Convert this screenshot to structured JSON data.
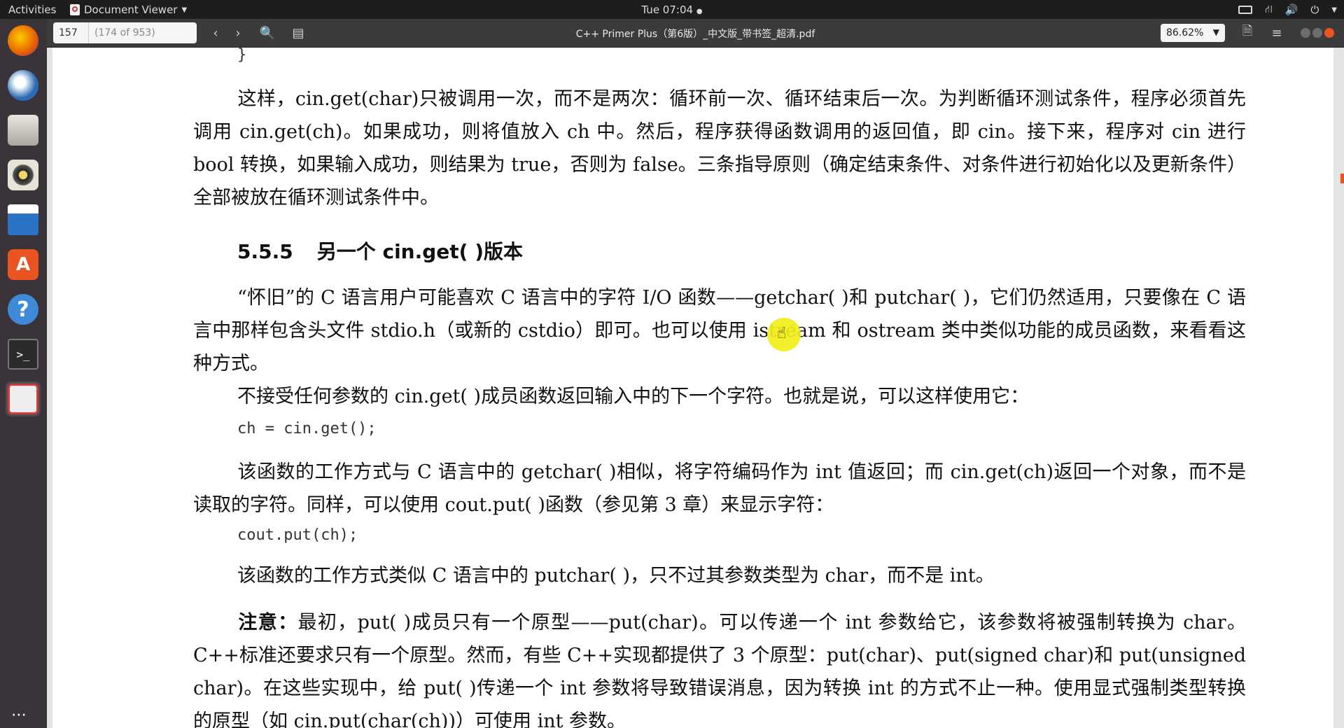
{
  "topbar": {
    "activities": "Activities",
    "app_name": "Document Viewer",
    "clock": "Tue 07:04"
  },
  "dock": {
    "items": [
      {
        "name": "firefox-icon",
        "color": "#e66000"
      },
      {
        "name": "thunderbird-icon",
        "color": "#2b6cb5"
      },
      {
        "name": "files-icon",
        "color": "#b9b6b0"
      },
      {
        "name": "rhythmbox-icon",
        "color": "#d9c25a"
      },
      {
        "name": "libreoffice-writer-icon",
        "color": "#2a73c7"
      },
      {
        "name": "ubuntu-software-icon",
        "color": "#e95420"
      },
      {
        "name": "help-icon",
        "color": "#3f8ad8"
      },
      {
        "name": "terminal-icon",
        "color": "#2b2b2b"
      },
      {
        "name": "document-viewer-icon",
        "color": "#e8e8e8"
      }
    ]
  },
  "header": {
    "page_number": "157",
    "page_of": "(174 of 953)",
    "title": "C++ Primer Plus（第6版）_中文版_带书签_超清.pdf",
    "zoom": "86.62%"
  },
  "content": {
    "code_brace": "}",
    "p1": "这样，cin.get(char)只被调用一次，而不是两次：循环前一次、循环结束后一次。为判断循环测试条件，程序必须首先调用 cin.get(ch)。如果成功，则将值放入 ch 中。然后，程序获得函数调用的返回值，即 cin。接下来，程序对 cin 进行 bool 转换，如果输入成功，则结果为 true，否则为 false。三条指导原则（确定结束条件、对条件进行初始化以及更新条件）全部被放在循环测试条件中。",
    "heading_num": "5.5.5",
    "heading_text": "另一个 cin.get( )版本",
    "p2": "“怀旧”的 C 语言用户可能喜欢 C 语言中的字符 I/O 函数——getchar( )和 putchar( )，它们仍然适用，只要像在 C 语言中那样包含头文件 stdio.h（或新的 cstdio）即可。也可以使用 istream 和 ostream 类中类似功能的成员函数，来看看这种方式。",
    "p3": "不接受任何参数的 cin.get( )成员函数返回输入中的下一个字符。也就是说，可以这样使用它：",
    "code1": "ch = cin.get();",
    "p4": "该函数的工作方式与 C 语言中的 getchar( )相似，将字符编码作为 int 值返回；而 cin.get(ch)返回一个对象，而不是读取的字符。同样，可以使用 cout.put( )函数（参见第 3 章）来显示字符：",
    "code2": "cout.put(ch);",
    "p5": "该函数的工作方式类似 C 语言中的 putchar( )，只不过其参数类型为 char，而不是 int。",
    "note_label": "注意：",
    "note_text": "最初，put( )成员只有一个原型——put(char)。可以传递一个 int 参数给它，该参数将被强制转换为 char。C++标准还要求只有一个原型。然而，有些 C++实现都提供了 3 个原型：put(char)、put(signed char)和 put(unsigned char)。在这些实现中，给 put( )传递一个 int 参数将导致错误消息，因为转换 int 的方式不止一种。使用显式强制类型转换的原型（如 cin.put(char(ch))）可使用 int 参数。"
  }
}
